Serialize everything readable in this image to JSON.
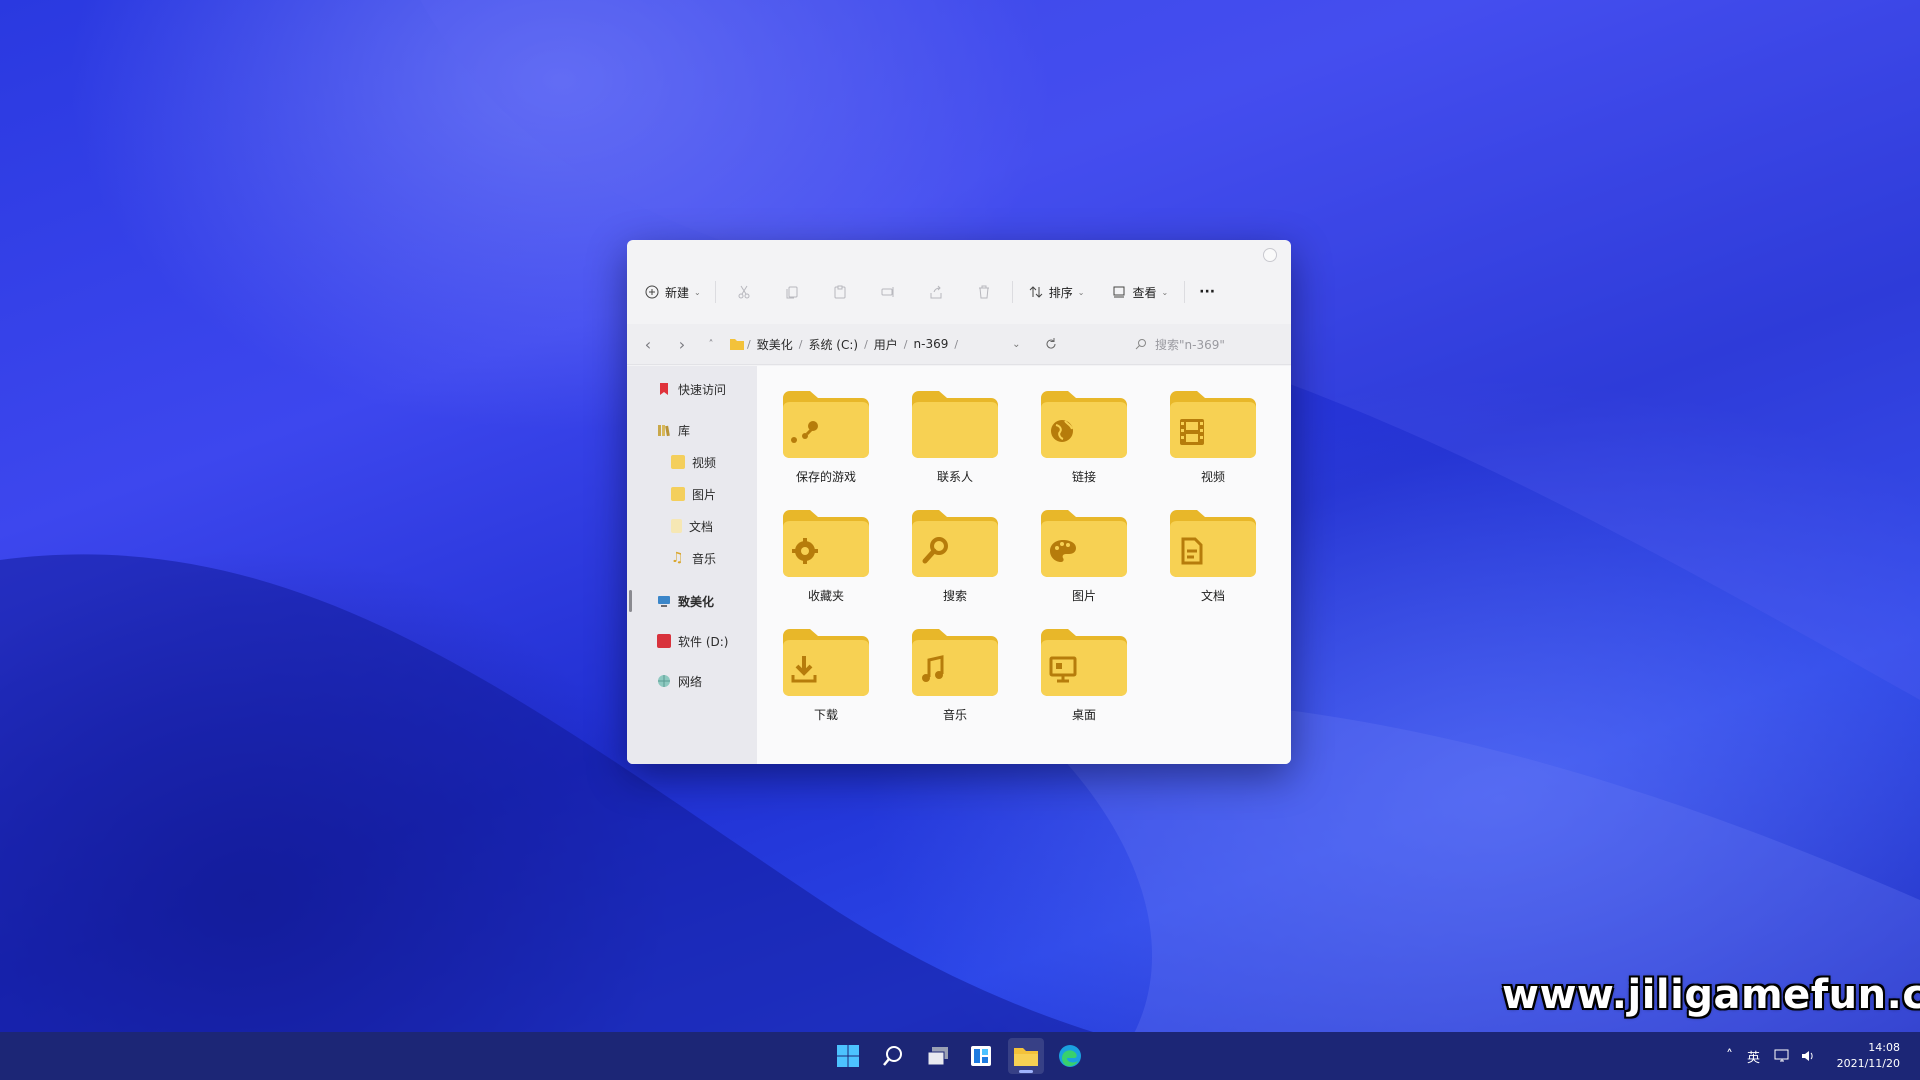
{
  "colors": {
    "accent": "#f3c23a",
    "folder": "#f7d153",
    "folder_back": "#e8b729",
    "icon_glyph": "#b67c0b"
  },
  "toolbar": {
    "new_label": "新建",
    "sort_label": "排序",
    "view_label": "查看",
    "more_label": "···"
  },
  "addressbar": {
    "crumbs": [
      "致美化",
      "系统 (C:)",
      "用户",
      "n-369"
    ],
    "search_placeholder": "搜索\"n-369\""
  },
  "sidebar": {
    "quick_access": "快速访问",
    "library": "库",
    "lib_items": [
      "视频",
      "图片",
      "文档",
      "音乐"
    ],
    "this_pc": "致美化",
    "drive_d": "软件 (D:)",
    "network": "网络"
  },
  "folders": [
    {
      "label": "保存的游戏",
      "icon": "steam-icon"
    },
    {
      "label": "联系人",
      "icon": "none"
    },
    {
      "label": "链接",
      "icon": "globe-icon"
    },
    {
      "label": "视频",
      "icon": "film-icon"
    },
    {
      "label": "收藏夹",
      "icon": "gear-icon"
    },
    {
      "label": "搜索",
      "icon": "search-icon"
    },
    {
      "label": "图片",
      "icon": "palette-icon"
    },
    {
      "label": "文档",
      "icon": "document-icon"
    },
    {
      "label": "下载",
      "icon": "download-icon"
    },
    {
      "label": "音乐",
      "icon": "music-icon"
    },
    {
      "label": "桌面",
      "icon": "monitor-icon"
    }
  ],
  "taskbar": {
    "tray_lang": "英",
    "time": "14:08",
    "date": "2021/11/20"
  },
  "watermark": "www.jiligamefun.com"
}
